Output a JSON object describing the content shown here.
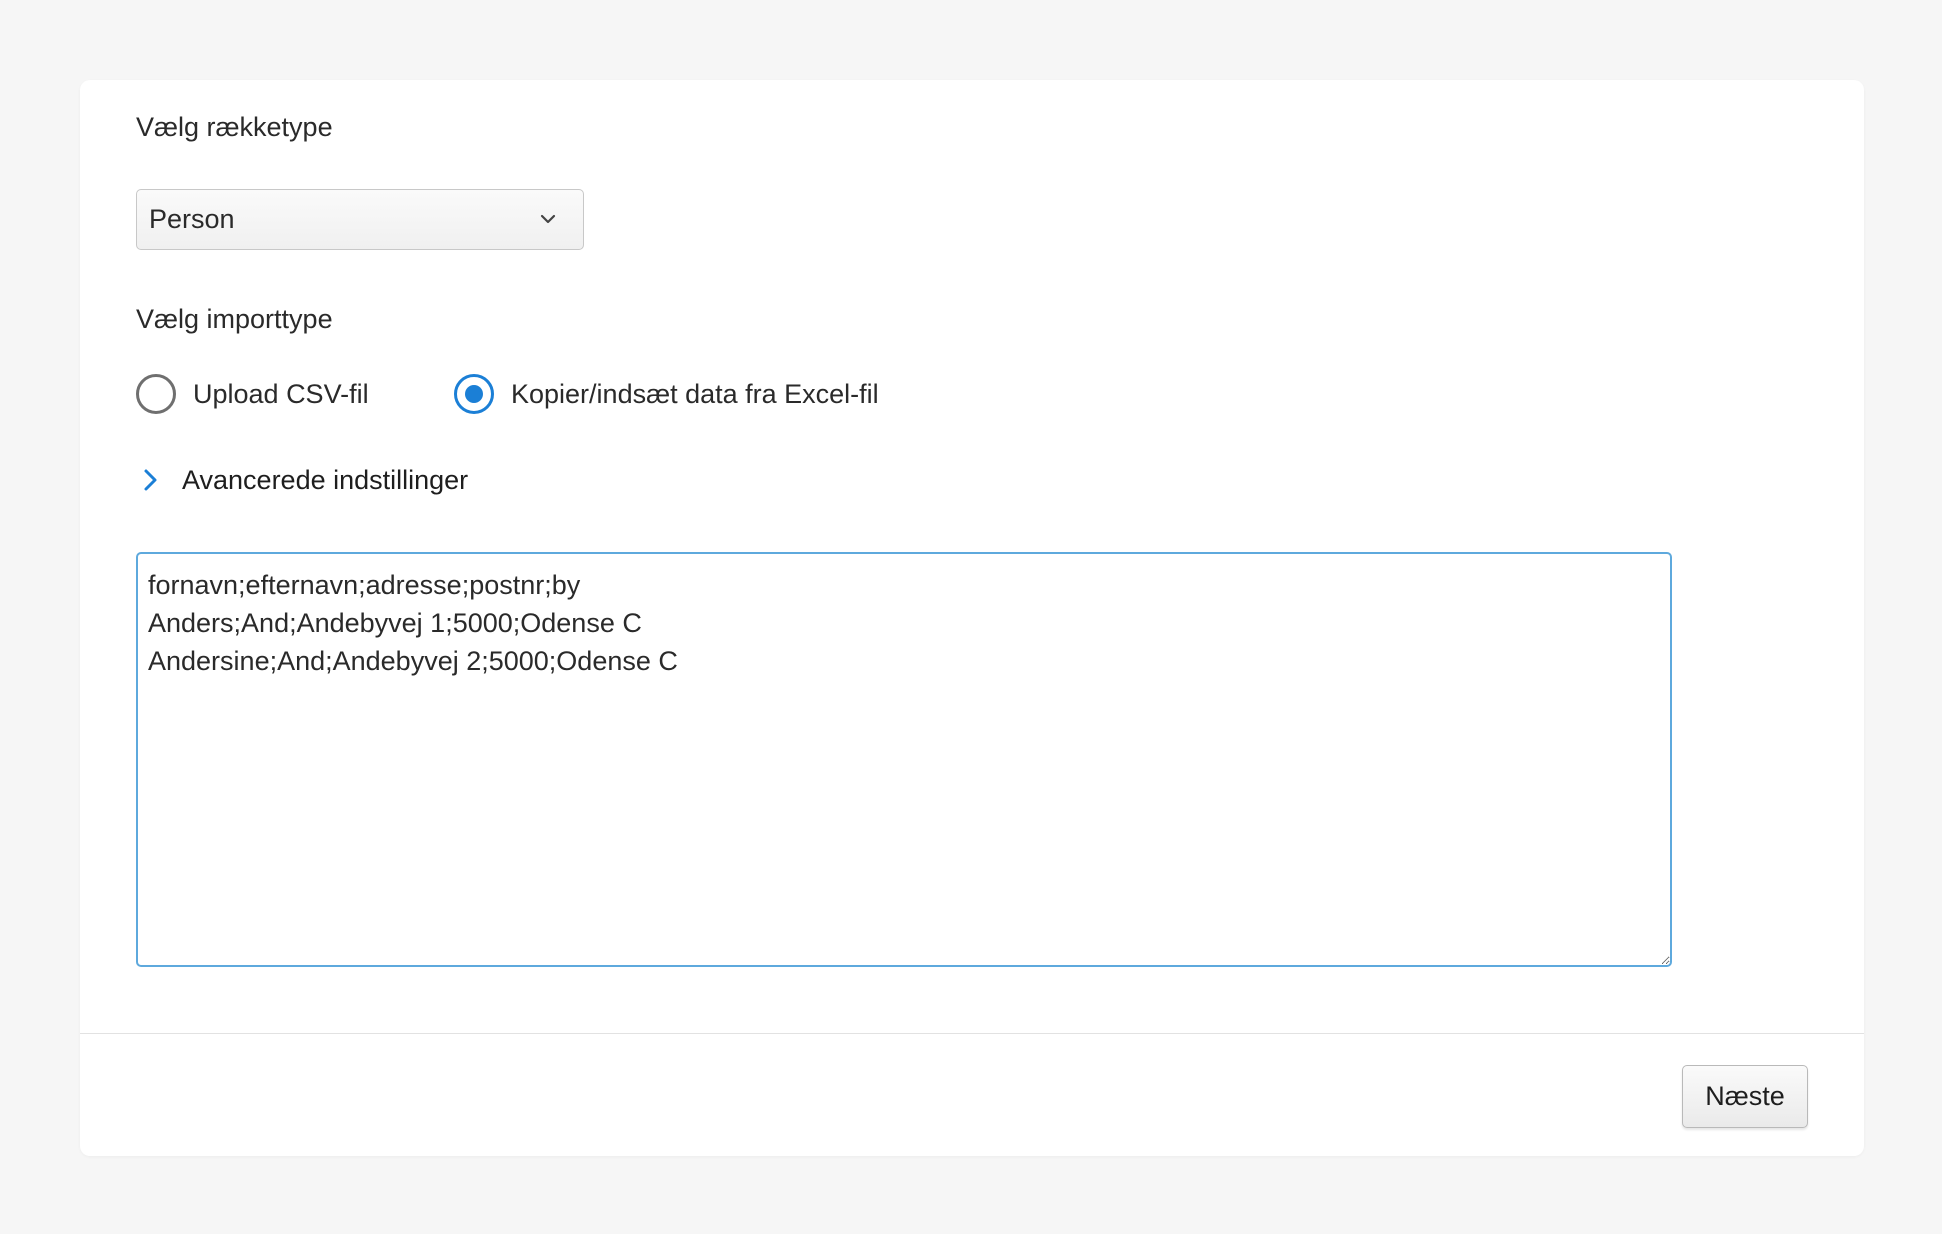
{
  "form": {
    "row_type_label": "Vælg rækketype",
    "row_type_selected": "Person",
    "import_type_label": "Vælg importtype",
    "import_options": [
      {
        "label": "Upload CSV-fil",
        "checked": false
      },
      {
        "label": "Kopier/indsæt data fra Excel-fil",
        "checked": true
      }
    ],
    "advanced_label": "Avancerede indstillinger",
    "pasted_data": "fornavn;efternavn;adresse;postnr;by\nAnders;And;Andebyvej 1;5000;Odense C\nAndersine;And;Andebyvej 2;5000;Odense C"
  },
  "footer": {
    "next_label": "Næste"
  },
  "colors": {
    "accent": "#1b7fd6",
    "textarea_border": "#5ea9dd",
    "page_background": "#f6f6f6"
  },
  "icons": {
    "select": "chevron-down-icon",
    "advanced": "chevron-right-icon"
  }
}
